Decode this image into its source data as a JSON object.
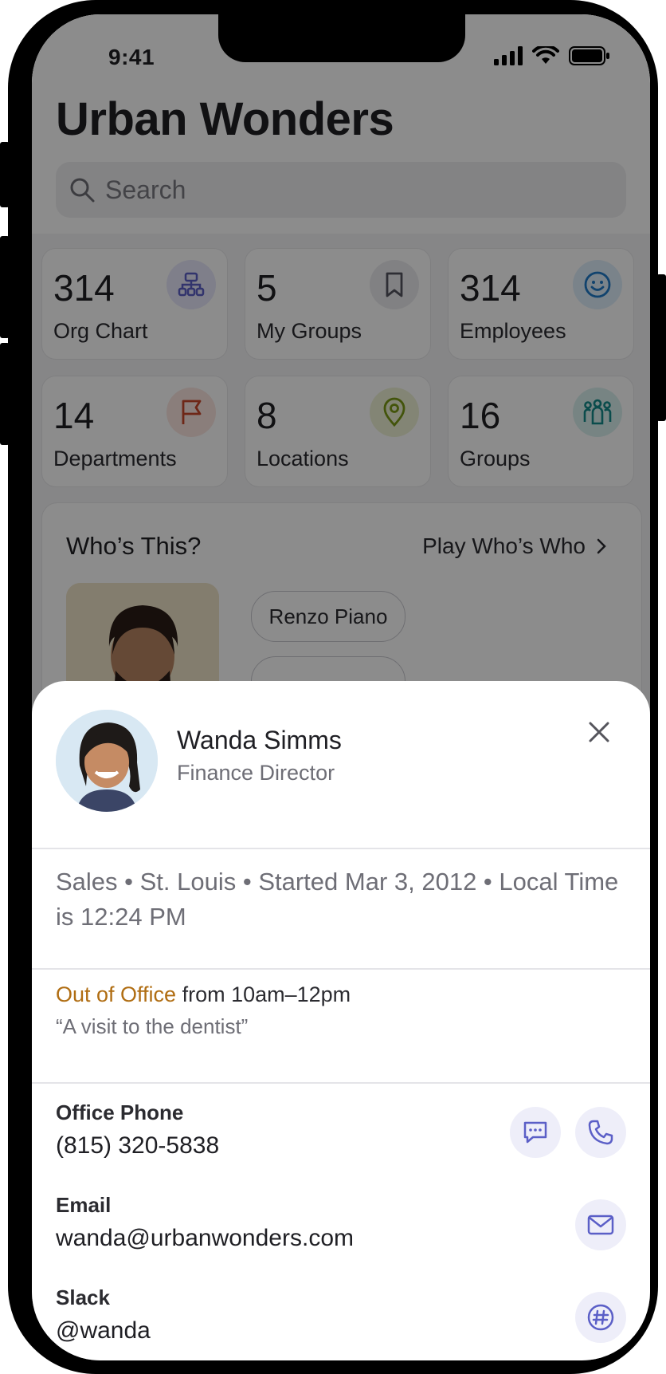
{
  "status_bar": {
    "time": "9:41"
  },
  "app": {
    "title": "Urban Wonders"
  },
  "search": {
    "placeholder": "Search"
  },
  "stats": [
    {
      "value": "314",
      "label": "Org Chart",
      "icon": "org-chart-icon",
      "color": "#5b5fc7"
    },
    {
      "value": "5",
      "label": "My Groups",
      "icon": "bookmark-icon",
      "color": "#555560"
    },
    {
      "value": "314",
      "label": "Employees",
      "icon": "smiley-icon",
      "color": "#1f7ac9"
    },
    {
      "value": "14",
      "label": "Departments",
      "icon": "flag-icon",
      "color": "#c9472b"
    },
    {
      "value": "8",
      "label": "Locations",
      "icon": "location-pin-icon",
      "color": "#7a9a14"
    },
    {
      "value": "16",
      "label": "Groups",
      "icon": "people-icon",
      "color": "#138a8a"
    }
  ],
  "whos_this": {
    "title": "Who’s This?",
    "link": "Play Who’s Who",
    "options": [
      "Renzo Piano"
    ]
  },
  "profile": {
    "name": "Wanda Simms",
    "role": "Finance Director",
    "meta": "Sales • St. Louis • Started Mar 3, 2012 • Local Time is 12:24 PM",
    "status_highlight": "Out of Office",
    "status_rest": " from 10am–12pm",
    "status_quote": "“A visit to the dentist”",
    "fields": [
      {
        "label": "Office Phone",
        "value": "(815) 320-5838"
      },
      {
        "label": "Email",
        "value": "wanda@urbanwonders.com"
      },
      {
        "label": "Slack",
        "value": "@wanda"
      }
    ]
  },
  "colors": {
    "accent": "#5b5fc7",
    "out_of_office": "#b06d12"
  }
}
